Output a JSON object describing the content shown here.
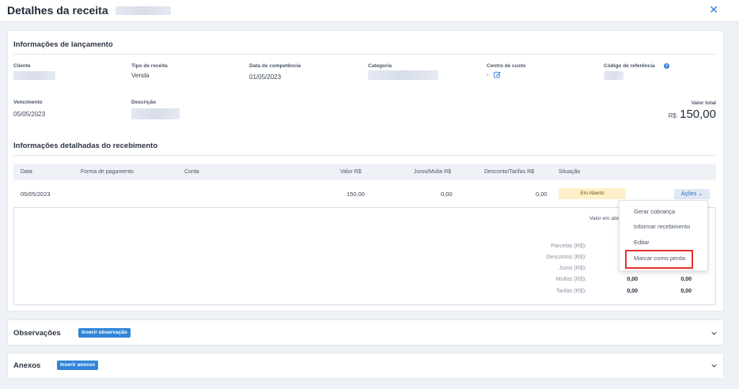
{
  "header": {
    "title": "Detalhes da receita",
    "close_glyph": "✕"
  },
  "lancamento": {
    "title": "Informações de lançamento",
    "cliente_label": "Cliente",
    "tipo_label": "Tipo de receita",
    "tipo_value": "Venda",
    "competencia_label": "Data de competência",
    "competencia_value": "01/05/2023",
    "categoria_label": "Categoria",
    "centro_label": "Centro de custo",
    "centro_value": "-",
    "codigo_label": "Código de referência",
    "vencimento_label": "Vencimento",
    "vencimento_value": "05/05/2023",
    "descricao_label": "Descrição",
    "total_label": "Valor total",
    "total_currency": "R$",
    "total_value": "150,00"
  },
  "recebimento": {
    "title": "Informações detalhadas do recebimento",
    "columns": [
      "Data",
      "Forma de pagamento",
      "Conta",
      "Valor R$",
      "Juros/Multa R$",
      "Desconto/Tarifas R$",
      "Situação"
    ],
    "row": {
      "data": "05/05/2023",
      "valor": "150,00",
      "juros": "0,00",
      "desconto": "0,00",
      "situacao": "Em Aberto",
      "acoes": "Ações ⌄"
    },
    "summary": {
      "valor_em_aberto": "Valor em abe",
      "labels": [
        "Parcelas (R$):",
        "Descontos (R$):",
        "Juros (R$):",
        "Multas (R$):",
        "Tarifas (R$):"
      ],
      "multas_values": [
        "0,00",
        "0,00"
      ],
      "tarifas_values": [
        "0,00",
        "0,00"
      ]
    }
  },
  "menu": {
    "items": [
      "Gerar cobrança",
      "Informar recebimento",
      "Editar",
      "Marcar como perda"
    ]
  },
  "observacoes": {
    "title": "Observações",
    "button": "Inserir observação"
  },
  "anexos": {
    "title": "Anexos",
    "button": "Inserir anexos"
  },
  "colors": {
    "accent": "#2f85d8",
    "highlight": "#e5322d",
    "badge_bg": "#fdf0c8"
  },
  "icons": [
    "close-icon",
    "help-icon",
    "edit-icon",
    "chevron-down-icon"
  ]
}
